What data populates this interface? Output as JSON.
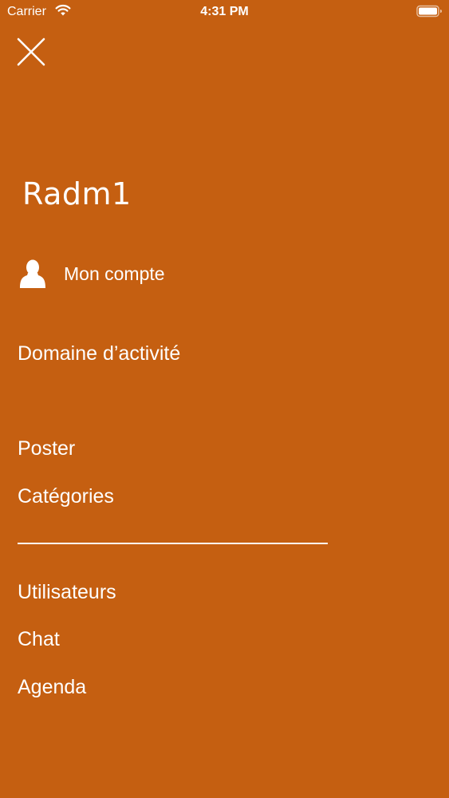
{
  "status_bar": {
    "carrier": "Carrier",
    "time": "4:31 PM",
    "wifi_icon": "wifi-icon",
    "battery_icon": "battery-icon"
  },
  "menu": {
    "close_icon": "close-icon",
    "profile_name": "Radm1",
    "account": {
      "icon": "user-icon",
      "label": "Mon compte"
    },
    "items": [
      {
        "label": "Domaine d’activité"
      },
      {
        "label": "Poster"
      },
      {
        "label": "Catégories"
      },
      {
        "label": "Utilisateurs"
      },
      {
        "label": "Chat"
      },
      {
        "label": "Agenda"
      }
    ]
  },
  "colors": {
    "background": "#c55f11",
    "text": "#ffffff"
  }
}
